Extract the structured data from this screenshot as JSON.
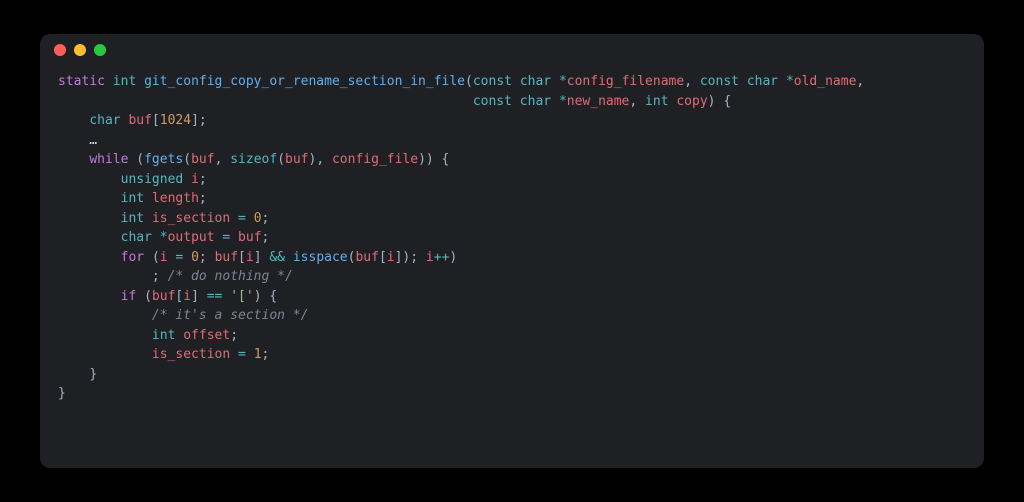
{
  "editor": {
    "colors": {
      "bg": "#1e2024",
      "fg": "#d8dee9",
      "keyword": "#c678dd",
      "type": "#56b6c2",
      "function": "#61afef",
      "variable": "#e06c75",
      "number": "#d19a66",
      "operator": "#56b6c2",
      "string": "#98c379",
      "comment": "#7f848e",
      "punct": "#abb2bf"
    }
  },
  "code": {
    "tokens": [
      [
        [
          "kw",
          "static"
        ],
        [
          "",
          ""
        ],
        [
          "",
          " "
        ],
        [
          "type",
          "int"
        ],
        [
          "",
          " "
        ],
        [
          "fn",
          "git_config_copy_or_rename_section_in_file"
        ],
        [
          "punc",
          "("
        ],
        [
          "type",
          "const"
        ],
        [
          "",
          " "
        ],
        [
          "type",
          "char"
        ],
        [
          "",
          " "
        ],
        [
          "op",
          "*"
        ],
        [
          "var",
          "config_filename"
        ],
        [
          "punc",
          ", "
        ],
        [
          "type",
          "const"
        ],
        [
          "",
          " "
        ],
        [
          "type",
          "char"
        ],
        [
          "",
          " "
        ],
        [
          "op",
          "*"
        ],
        [
          "var",
          "old_name"
        ],
        [
          "punc",
          ","
        ]
      ],
      [
        [
          "",
          "                                                     "
        ],
        [
          "type",
          "const"
        ],
        [
          "",
          " "
        ],
        [
          "type",
          "char"
        ],
        [
          "",
          " "
        ],
        [
          "op",
          "*"
        ],
        [
          "var",
          "new_name"
        ],
        [
          "punc",
          ", "
        ],
        [
          "type",
          "int"
        ],
        [
          "",
          " "
        ],
        [
          "var",
          "copy"
        ],
        [
          "punc",
          ") {"
        ]
      ],
      [
        [
          "",
          "    "
        ],
        [
          "type",
          "char"
        ],
        [
          "",
          " "
        ],
        [
          "var",
          "buf"
        ],
        [
          "punc",
          "["
        ],
        [
          "num",
          "1024"
        ],
        [
          "punc",
          "];"
        ]
      ],
      [
        [
          "",
          "    …"
        ]
      ],
      [
        [
          "",
          "    "
        ],
        [
          "kw",
          "while"
        ],
        [
          "",
          " "
        ],
        [
          "punc",
          "("
        ],
        [
          "fn",
          "fgets"
        ],
        [
          "punc",
          "("
        ],
        [
          "var",
          "buf"
        ],
        [
          "punc",
          ", "
        ],
        [
          "type",
          "sizeof"
        ],
        [
          "punc",
          "("
        ],
        [
          "var",
          "buf"
        ],
        [
          "punc",
          "), "
        ],
        [
          "var",
          "config_file"
        ],
        [
          "punc",
          ")) {"
        ]
      ],
      [
        [
          "",
          "        "
        ],
        [
          "type",
          "unsigned"
        ],
        [
          "",
          " "
        ],
        [
          "var",
          "i"
        ],
        [
          "punc",
          ";"
        ]
      ],
      [
        [
          "",
          "        "
        ],
        [
          "type",
          "int"
        ],
        [
          "",
          " "
        ],
        [
          "var",
          "length"
        ],
        [
          "punc",
          ";"
        ]
      ],
      [
        [
          "",
          "        "
        ],
        [
          "type",
          "int"
        ],
        [
          "",
          " "
        ],
        [
          "var",
          "is_section"
        ],
        [
          "",
          " "
        ],
        [
          "op",
          "="
        ],
        [
          "",
          " "
        ],
        [
          "num",
          "0"
        ],
        [
          "punc",
          ";"
        ]
      ],
      [
        [
          "",
          "        "
        ],
        [
          "type",
          "char"
        ],
        [
          "",
          " "
        ],
        [
          "op",
          "*"
        ],
        [
          "var",
          "output"
        ],
        [
          "",
          " "
        ],
        [
          "op",
          "="
        ],
        [
          "",
          " "
        ],
        [
          "var",
          "buf"
        ],
        [
          "punc",
          ";"
        ]
      ],
      [
        [
          "",
          "        "
        ],
        [
          "kw",
          "for"
        ],
        [
          "",
          " "
        ],
        [
          "punc",
          "("
        ],
        [
          "var",
          "i"
        ],
        [
          "",
          " "
        ],
        [
          "op",
          "="
        ],
        [
          "",
          " "
        ],
        [
          "num",
          "0"
        ],
        [
          "punc",
          "; "
        ],
        [
          "var",
          "buf"
        ],
        [
          "punc",
          "["
        ],
        [
          "var",
          "i"
        ],
        [
          "punc",
          "] "
        ],
        [
          "op",
          "&&"
        ],
        [
          "",
          " "
        ],
        [
          "fn",
          "isspace"
        ],
        [
          "punc",
          "("
        ],
        [
          "var",
          "buf"
        ],
        [
          "punc",
          "["
        ],
        [
          "var",
          "i"
        ],
        [
          "punc",
          "]); "
        ],
        [
          "var",
          "i"
        ],
        [
          "op",
          "++"
        ],
        [
          "punc",
          ")"
        ]
      ],
      [
        [
          "",
          "            "
        ],
        [
          "punc",
          "; "
        ],
        [
          "cm",
          "/* do nothing */"
        ]
      ],
      [
        [
          "",
          "        "
        ],
        [
          "kw",
          "if"
        ],
        [
          "",
          " "
        ],
        [
          "punc",
          "("
        ],
        [
          "var",
          "buf"
        ],
        [
          "punc",
          "["
        ],
        [
          "var",
          "i"
        ],
        [
          "punc",
          "] "
        ],
        [
          "op",
          "=="
        ],
        [
          "",
          " "
        ],
        [
          "str",
          "'['"
        ],
        [
          "punc",
          ") {"
        ]
      ],
      [
        [
          "",
          "            "
        ],
        [
          "cm",
          "/* it's a section */"
        ]
      ],
      [
        [
          "",
          "            "
        ],
        [
          "type",
          "int"
        ],
        [
          "",
          " "
        ],
        [
          "var",
          "offset"
        ],
        [
          "punc",
          ";"
        ]
      ],
      [
        [
          "",
          "            "
        ],
        [
          "var",
          "is_section"
        ],
        [
          "",
          " "
        ],
        [
          "op",
          "="
        ],
        [
          "",
          " "
        ],
        [
          "num",
          "1"
        ],
        [
          "punc",
          ";"
        ]
      ],
      [
        [
          "",
          "    "
        ],
        [
          "punc",
          "}"
        ]
      ],
      [
        [
          "punc",
          "}"
        ]
      ]
    ]
  }
}
